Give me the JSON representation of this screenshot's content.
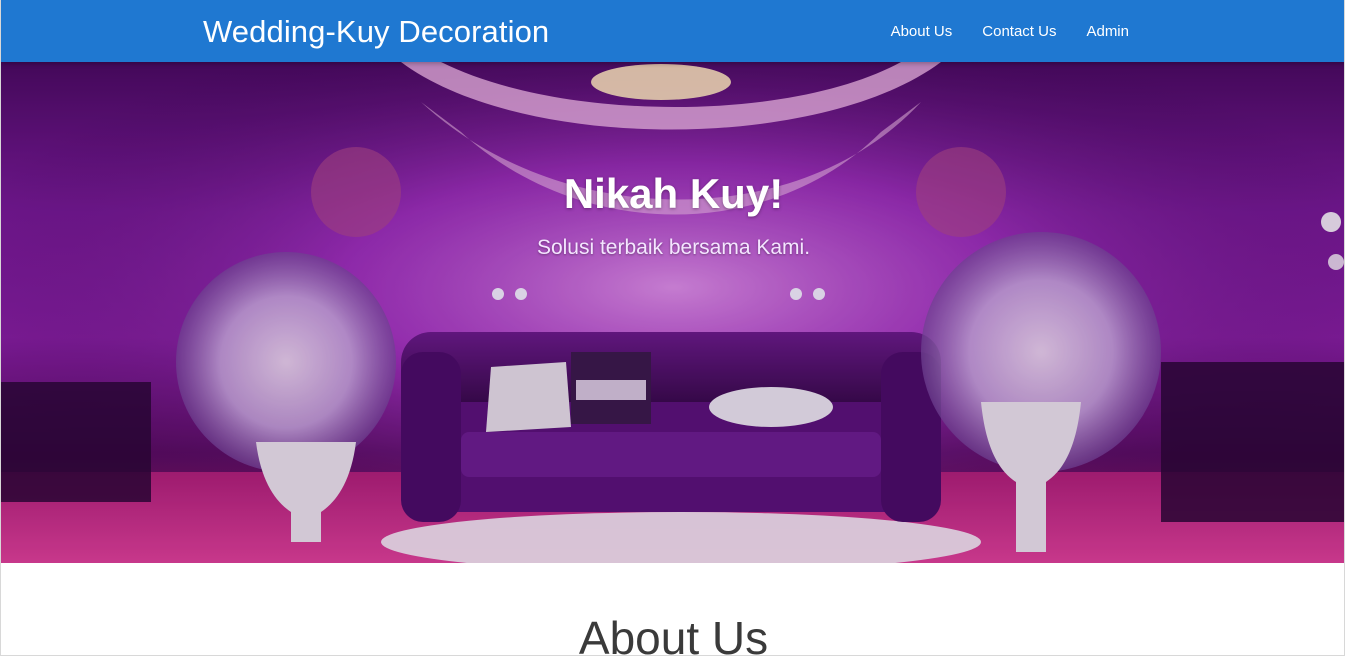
{
  "navbar": {
    "brand": "Wedding-Kuy Decoration",
    "links": [
      "About Us",
      "Contact Us",
      "Admin"
    ],
    "background": "#1f78d1"
  },
  "hero": {
    "title": "Nikah Kuy!",
    "subtitle": "Solusi terbaik bersama Kami.",
    "image": "wedding-stage-photo"
  },
  "about": {
    "title": "About Us"
  }
}
